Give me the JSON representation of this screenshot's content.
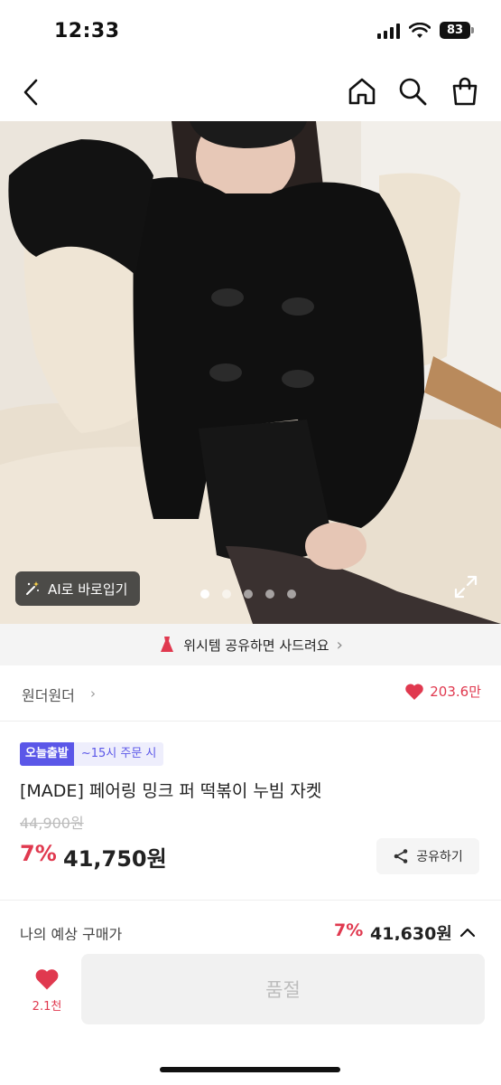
{
  "status_bar": {
    "time": "12:33",
    "battery": "83"
  },
  "nav": {
    "back_icon": "chevron-left-icon",
    "home_icon": "home-icon",
    "search_icon": "search-icon",
    "bag_icon": "shopping-bag-icon"
  },
  "gallery": {
    "ai_button_label": "AI로 바로입기",
    "ai_icon": "magic-wand-icon",
    "total_images": 5,
    "active_index": 0,
    "expand_icon": "expand-icon"
  },
  "wish_banner": {
    "text": "위시템 공유하면 사드려요",
    "chevron": "›"
  },
  "brand": {
    "name": "원더원더",
    "chevron": "›",
    "likes": "203.6만"
  },
  "badges": {
    "today": "오늘출발",
    "cutoff": "~15시 주문 시"
  },
  "product": {
    "title": "[MADE] 페어링 밍크 퍼 떡볶이 누빔 자켓",
    "original_price": "44,900원",
    "discount": "7%",
    "price": "41,750원",
    "share_label": "공유하기"
  },
  "budget": {
    "label": "나의 예상 구매가",
    "discount": "7%",
    "price": "41,630원"
  },
  "bottom": {
    "like_count": "2.1천",
    "soldout_label": "품절"
  },
  "colors": {
    "accent": "#e0394f",
    "badge": "#5b57e8"
  }
}
